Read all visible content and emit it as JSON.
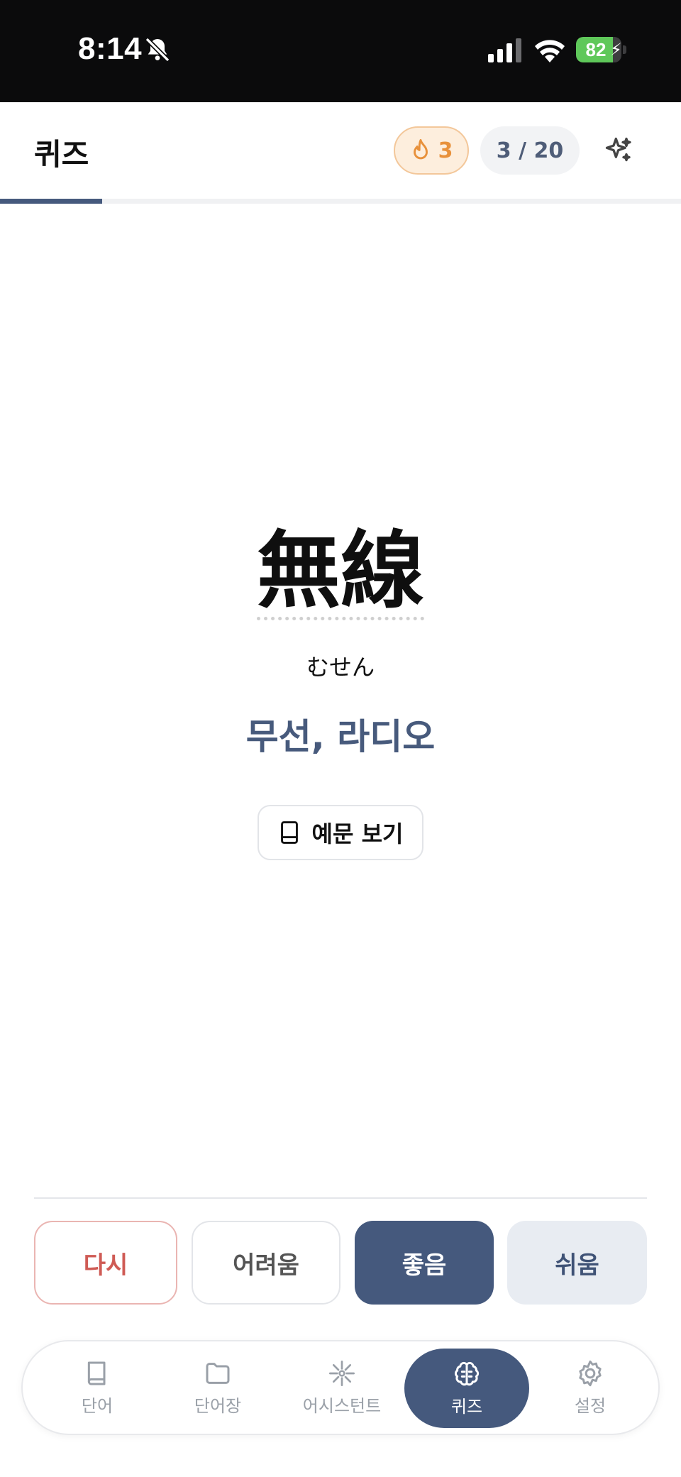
{
  "status_bar": {
    "time": "8:14",
    "battery": "82",
    "battery_level": 0.82
  },
  "header": {
    "title": "퀴즈",
    "streak_count": "3",
    "progress_text": "3 / 20",
    "progress_fraction": 0.15
  },
  "card": {
    "word": "無線",
    "reading": "むせん",
    "meaning": "무선, 라디오",
    "example_button": "예문 보기"
  },
  "ratings": {
    "again": "다시",
    "hard": "어려움",
    "good": "좋음",
    "easy": "쉬움"
  },
  "nav": {
    "items": [
      {
        "label": "단어",
        "icon": "book-icon"
      },
      {
        "label": "단어장",
        "icon": "folder-icon"
      },
      {
        "label": "어시스턴트",
        "icon": "sparkle-icon"
      },
      {
        "label": "퀴즈",
        "icon": "brain-icon",
        "active": true
      },
      {
        "label": "설정",
        "icon": "gear-icon"
      }
    ]
  },
  "colors": {
    "accent": "#45597d",
    "streak": "#e8913b",
    "again": "#cf5b55"
  }
}
